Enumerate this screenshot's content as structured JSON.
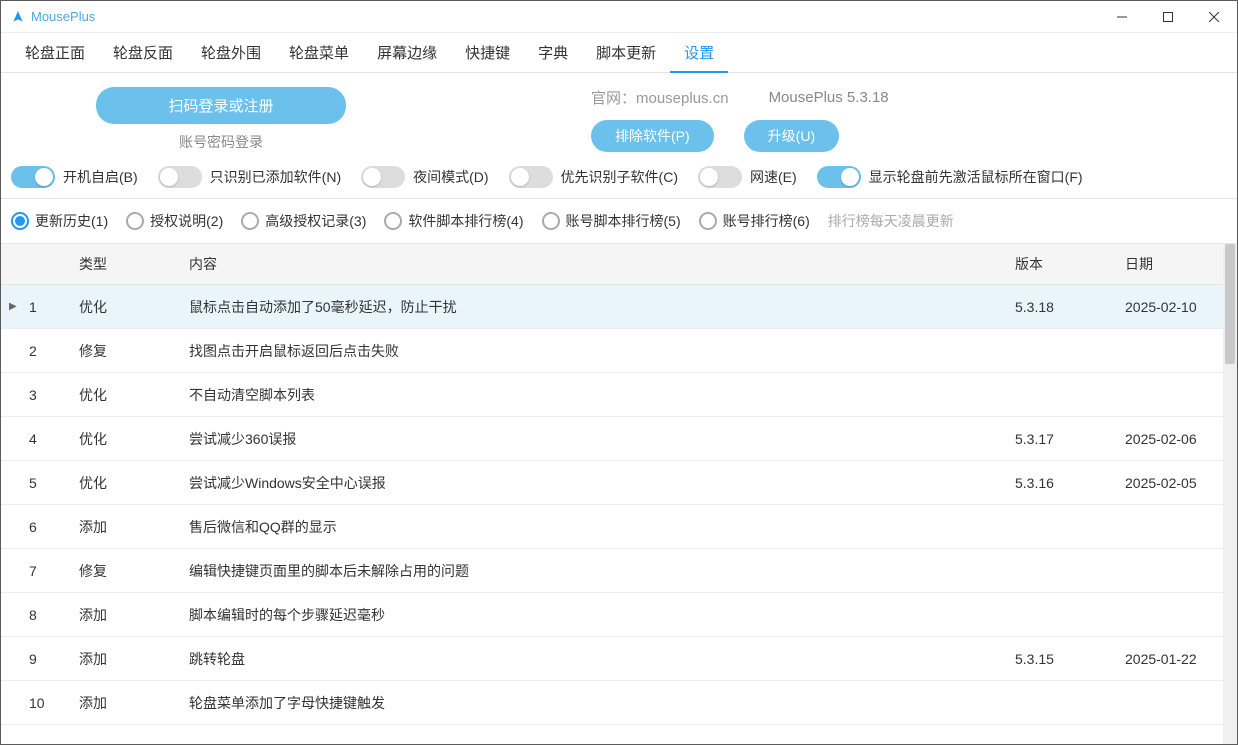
{
  "window": {
    "title": "MousePlus"
  },
  "menu": {
    "items": [
      "轮盘正面",
      "轮盘反面",
      "轮盘外围",
      "轮盘菜单",
      "屏幕边缘",
      "快捷键",
      "字典",
      "脚本更新",
      "设置"
    ],
    "active_index": 8
  },
  "header": {
    "login_btn": "扫码登录或注册",
    "login_alt": "账号密码登录",
    "site_label": "官网：mouseplus.cn",
    "version": "MousePlus 5.3.18",
    "exclude_btn": "排除软件(P)",
    "upgrade_btn": "升级(U)"
  },
  "toggles": [
    {
      "label": "开机自启(B)",
      "on": true
    },
    {
      "label": "只识别已添加软件(N)",
      "on": false
    },
    {
      "label": "夜间模式(D)",
      "on": false
    },
    {
      "label": "优先识别子软件(C)",
      "on": false
    },
    {
      "label": "网速(E)",
      "on": false
    },
    {
      "label": "显示轮盘前先激活鼠标所在窗口(F)",
      "on": true
    }
  ],
  "radios": {
    "items": [
      "更新历史(1)",
      "授权说明(2)",
      "高级授权记录(3)",
      "软件脚本排行榜(4)",
      "账号脚本排行榜(5)",
      "账号排行榜(6)"
    ],
    "checked_index": 0,
    "hint": "排行榜每天凌晨更新"
  },
  "table": {
    "headers": {
      "idx": "",
      "type": "类型",
      "content": "内容",
      "version": "版本",
      "date": "日期"
    },
    "rows": [
      {
        "idx": "1",
        "type": "优化",
        "content": "鼠标点击自动添加了50毫秒延迟，防止干扰",
        "version": "5.3.18",
        "date": "2025-02-10",
        "selected": true
      },
      {
        "idx": "2",
        "type": "修复",
        "content": "找图点击开启鼠标返回后点击失败",
        "version": "",
        "date": ""
      },
      {
        "idx": "3",
        "type": "优化",
        "content": "不自动清空脚本列表",
        "version": "",
        "date": ""
      },
      {
        "idx": "4",
        "type": "优化",
        "content": "尝试减少360误报",
        "version": "5.3.17",
        "date": "2025-02-06"
      },
      {
        "idx": "5",
        "type": "优化",
        "content": "尝试减少Windows安全中心误报",
        "version": "5.3.16",
        "date": "2025-02-05"
      },
      {
        "idx": "6",
        "type": "添加",
        "content": "售后微信和QQ群的显示",
        "version": "",
        "date": ""
      },
      {
        "idx": "7",
        "type": "修复",
        "content": "编辑快捷键页面里的脚本后未解除占用的问题",
        "version": "",
        "date": ""
      },
      {
        "idx": "8",
        "type": "添加",
        "content": "脚本编辑时的每个步骤延迟毫秒",
        "version": "",
        "date": ""
      },
      {
        "idx": "9",
        "type": "添加",
        "content": "跳转轮盘",
        "version": "5.3.15",
        "date": "2025-01-22"
      },
      {
        "idx": "10",
        "type": "添加",
        "content": "轮盘菜单添加了字母快捷键触发",
        "version": "",
        "date": ""
      }
    ]
  }
}
